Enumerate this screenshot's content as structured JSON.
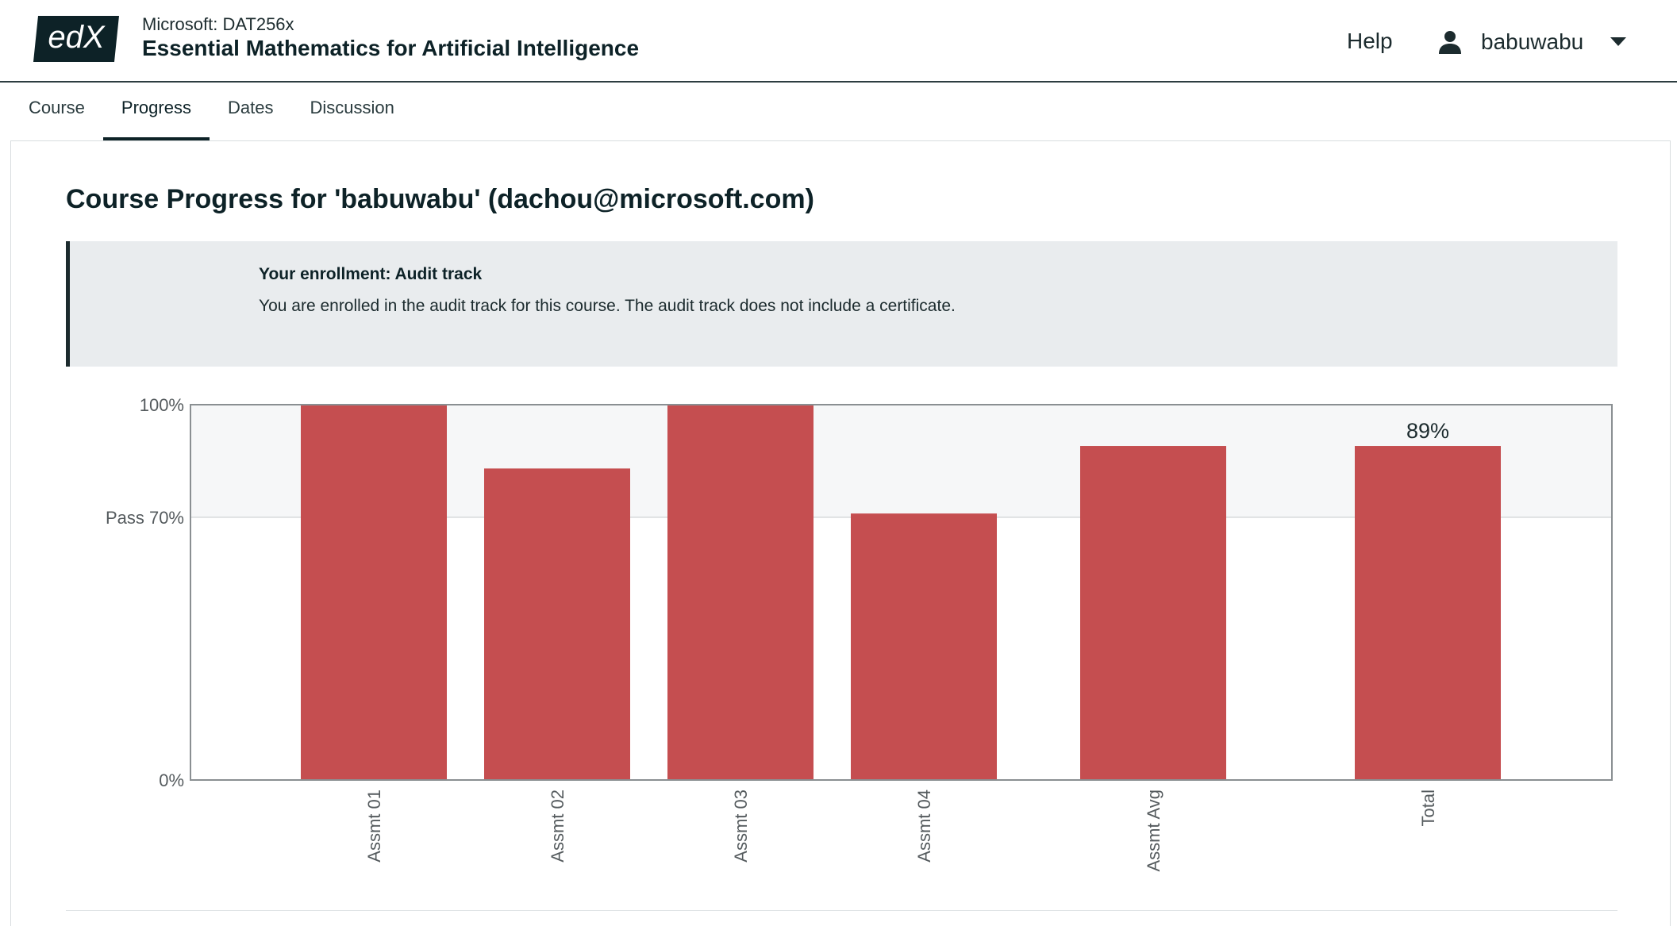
{
  "header": {
    "logo_text": "edX",
    "course_org": "Microsoft: DAT256x",
    "course_title": "Essential Mathematics for Artificial Intelligence",
    "help_label": "Help",
    "username": "babuwabu"
  },
  "tabs": [
    {
      "label": "Course",
      "active": false
    },
    {
      "label": "Progress",
      "active": true
    },
    {
      "label": "Dates",
      "active": false
    },
    {
      "label": "Discussion",
      "active": false
    }
  ],
  "main": {
    "title": "Course Progress for 'babuwabu' (dachou@microsoft.com)",
    "enrollment": {
      "heading": "Your enrollment: Audit track",
      "text": "You are enrolled in the audit track for this course. The audit track does not include a certificate."
    }
  },
  "colors": {
    "bar": "#c44a4c",
    "pass_band": "#f6f7f8",
    "header_border": "#2d3d40"
  },
  "chart_data": {
    "type": "bar",
    "categories": [
      "Assmt 01",
      "Assmt 02",
      "Assmt 03",
      "Assmt 04",
      "Assmt Avg",
      "Total"
    ],
    "values": [
      100,
      83,
      100,
      71,
      89,
      89
    ],
    "ytick_labels": [
      "100%",
      "Pass 70%",
      "0%"
    ],
    "ytick_values": [
      100,
      70,
      0
    ],
    "ylim": [
      0,
      100
    ],
    "pass_threshold": 70,
    "total_label": "89%",
    "x_label_rotation": "vertical",
    "grid": false
  }
}
